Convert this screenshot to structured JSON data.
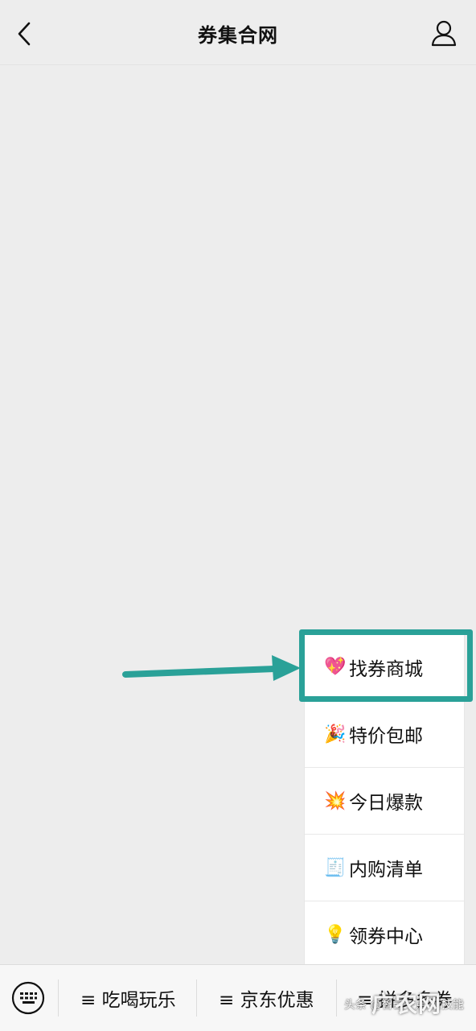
{
  "header": {
    "title": "券集合网",
    "back_icon": "chevron-left-icon",
    "user_icon": "person-icon"
  },
  "menu": {
    "items": [
      {
        "emoji": "💖",
        "label": "找券商城"
      },
      {
        "emoji": "🎉",
        "label": "特价包邮"
      },
      {
        "emoji": "💥",
        "label": "今日爆款"
      },
      {
        "emoji": "🧾",
        "label": "内购清单"
      },
      {
        "emoji": "💡",
        "label": "领券中心"
      }
    ]
  },
  "highlight_color": "#2aa198",
  "bottom_bar": {
    "keyboard_icon": "keyboard-icon",
    "items": [
      {
        "label": "≡ 吃喝玩乐"
      },
      {
        "label": "≡ 京东优惠"
      },
      {
        "label": "≡ 拼多多券"
      }
    ]
  },
  "watermark": {
    "small": "头条 @智云一点 新技能",
    "big": "广农网"
  }
}
